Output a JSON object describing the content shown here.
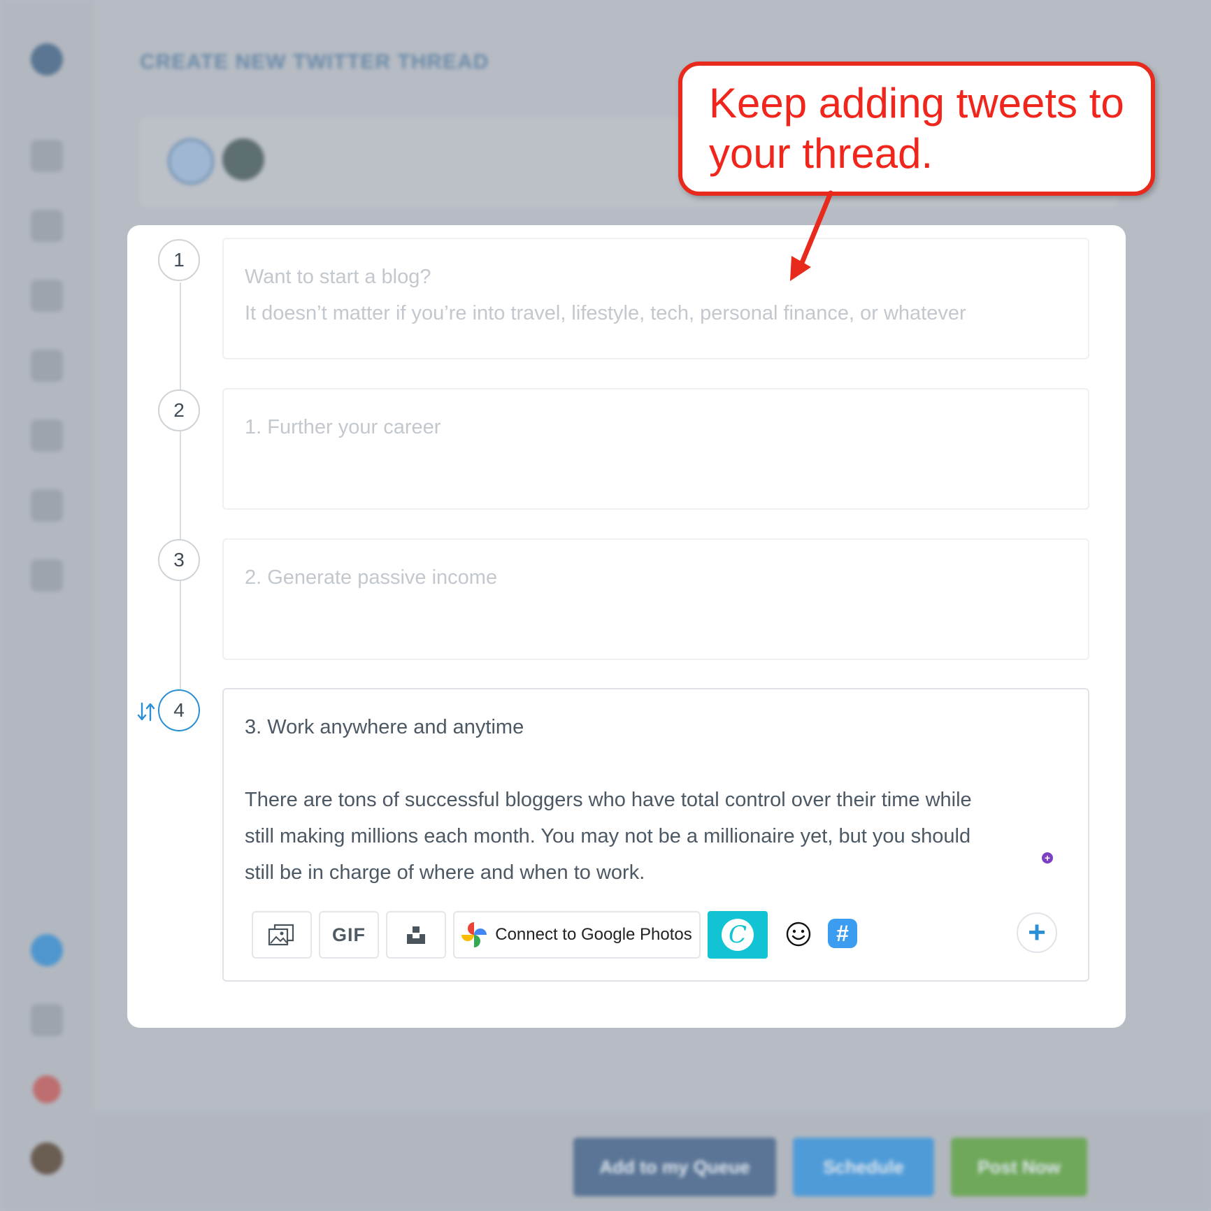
{
  "app": {
    "page_title": "CREATE NEW TWITTER THREAD"
  },
  "background_actions": {
    "add_to_queue": "Add to my Queue",
    "schedule": "Schedule",
    "post_now": "Post Now"
  },
  "thread": {
    "tweets": [
      {
        "number": "1",
        "lines": [
          "Want to start a blog?",
          "It doesn’t matter if you’re into travel, lifestyle, tech, personal finance, or whatever"
        ]
      },
      {
        "number": "2",
        "lines": [
          "1. Further your career"
        ]
      },
      {
        "number": "3",
        "lines": [
          "2. Generate passive income"
        ]
      },
      {
        "number": "4",
        "lines": [
          "3. Work anywhere and anytime",
          "There are tons of successful bloggers who have total control over their time while",
          "still making millions each month. You may not be a millionaire yet, but you should",
          "still be in charge of where and when to work."
        ]
      }
    ],
    "active_index": 3
  },
  "toolbar": {
    "gif_label": "GIF",
    "google_photos_label": "Connect to Google Photos",
    "canva_label": "C",
    "hashtag_label": "#",
    "add_label": "+"
  },
  "callout": {
    "text": "Keep adding tweets to your thread.",
    "line1": "Keep adding tweets to",
    "line2": "your thread.",
    "color": "#f0261c"
  },
  "colors": {
    "accent": "#2b8fd6",
    "canva": "#11c3d3",
    "callout_border": "#e82a1c"
  }
}
